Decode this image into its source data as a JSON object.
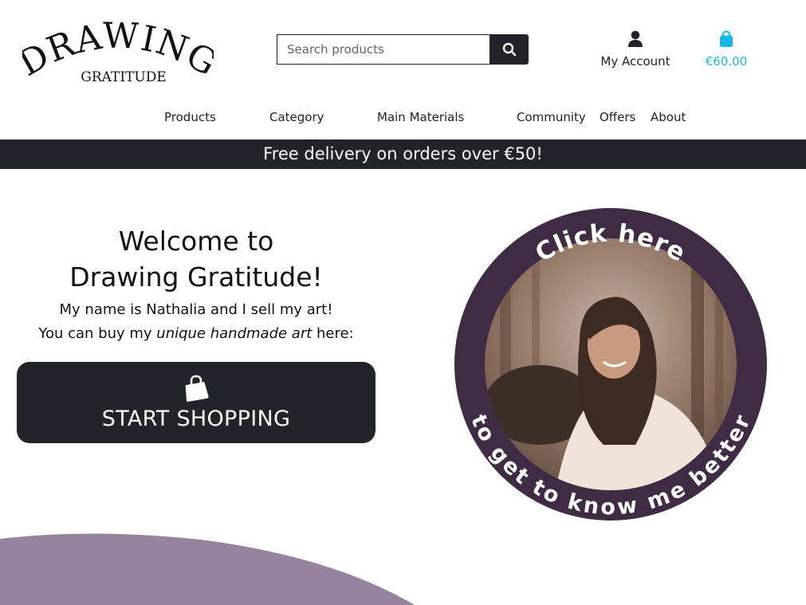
{
  "header": {
    "logo": {
      "line1": "DRAWING",
      "line2": "GRATITUDE"
    },
    "search": {
      "placeholder": "Search products"
    },
    "account": {
      "label": "My Account",
      "icon": "user-icon"
    },
    "bag": {
      "total": "€60.00",
      "icon": "shopping-bag-icon",
      "color": "#18b8e6"
    }
  },
  "nav": {
    "items": [
      "Products",
      "Category",
      "Main Materials",
      "Community",
      "Offers",
      "About"
    ]
  },
  "banner": {
    "text": "Free delivery on orders over €50!"
  },
  "hero": {
    "title_line1": "Welcome to",
    "title_line2": "Drawing Gratitude!",
    "line1": "My name is Nathalia and I sell my art!",
    "line2_start": "You can buy my",
    "line2_em": "unique handmade art",
    "line2_end": "here:",
    "button_label": "START SHOPPING",
    "button_icon": "shopping-bag-icon"
  },
  "about_circle": {
    "top_text": "Click here",
    "bottom_text": "to get to know me better",
    "ring_color": "#3f2b44"
  },
  "colors": {
    "dark": "#212529",
    "accent": "#18b8e6",
    "wave": "#9683a0"
  }
}
